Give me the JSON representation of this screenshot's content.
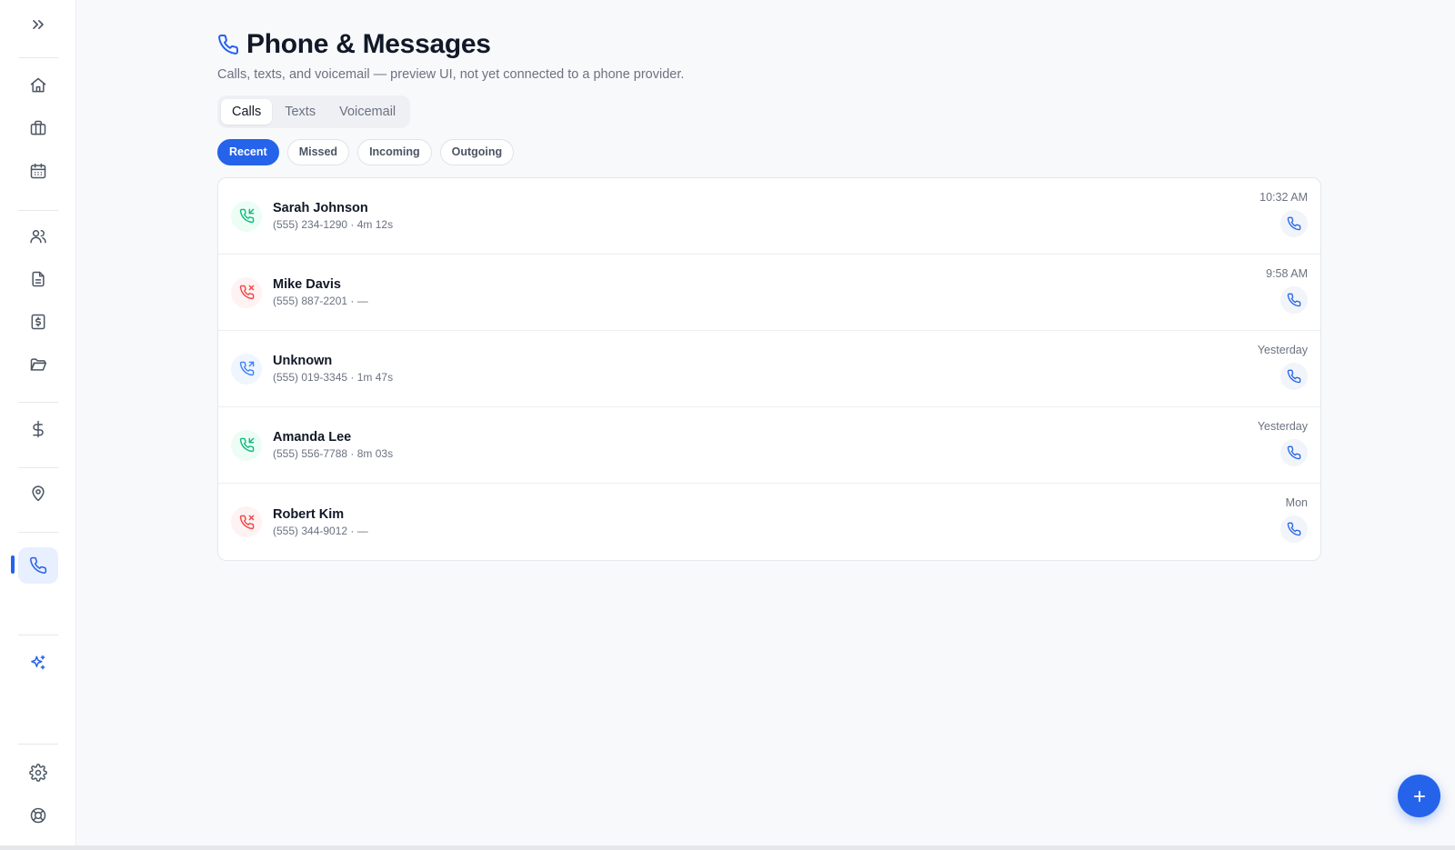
{
  "header": {
    "title": "Phone & Messages",
    "subtitle": "Calls, texts, and voicemail — preview UI, not yet connected to a phone provider."
  },
  "tabs": [
    {
      "label": "Calls",
      "active": true
    },
    {
      "label": "Texts",
      "active": false
    },
    {
      "label": "Voicemail",
      "active": false
    }
  ],
  "filters": [
    {
      "label": "Recent",
      "active": true
    },
    {
      "label": "Missed",
      "active": false
    },
    {
      "label": "Incoming",
      "active": false
    },
    {
      "label": "Outgoing",
      "active": false
    }
  ],
  "calls": [
    {
      "name": "Sarah Johnson",
      "meta": "(555) 234-1290 · 4m 12s",
      "time": "10:32 AM",
      "direction": "incoming",
      "icon": "phone-incoming-icon"
    },
    {
      "name": "Mike Davis",
      "meta": "(555) 887-2201 · —",
      "time": "9:58 AM",
      "direction": "missed",
      "icon": "phone-missed-icon"
    },
    {
      "name": "Unknown",
      "meta": "(555) 019-3345 · 1m 47s",
      "time": "Yesterday",
      "direction": "outgoing",
      "icon": "phone-outgoing-icon"
    },
    {
      "name": "Amanda Lee",
      "meta": "(555) 556-7788 · 8m 03s",
      "time": "Yesterday",
      "direction": "incoming",
      "icon": "phone-incoming-icon"
    },
    {
      "name": "Robert Kim",
      "meta": "(555) 344-9012 · —",
      "time": "Mon",
      "direction": "missed",
      "icon": "phone-missed-icon"
    }
  ],
  "sidebar": {
    "items": [
      {
        "icon": "expand-icon"
      },
      {
        "icon": "home-icon"
      },
      {
        "icon": "briefcase-icon"
      },
      {
        "icon": "calendar-icon"
      },
      {
        "icon": "users-icon"
      },
      {
        "icon": "document-icon"
      },
      {
        "icon": "invoice-icon"
      },
      {
        "icon": "folder-icon"
      },
      {
        "icon": "dollar-icon"
      },
      {
        "icon": "map-pin-icon"
      },
      {
        "icon": "phone-icon",
        "active": true
      },
      {
        "icon": "sparkles-icon"
      },
      {
        "icon": "settings-icon"
      },
      {
        "icon": "help-icon"
      }
    ]
  },
  "colors": {
    "accent": "#2563eb",
    "incoming": "#10b981",
    "missed": "#ef4444",
    "outgoing": "#3b82f6"
  },
  "fab": {
    "icon": "plus-icon"
  }
}
